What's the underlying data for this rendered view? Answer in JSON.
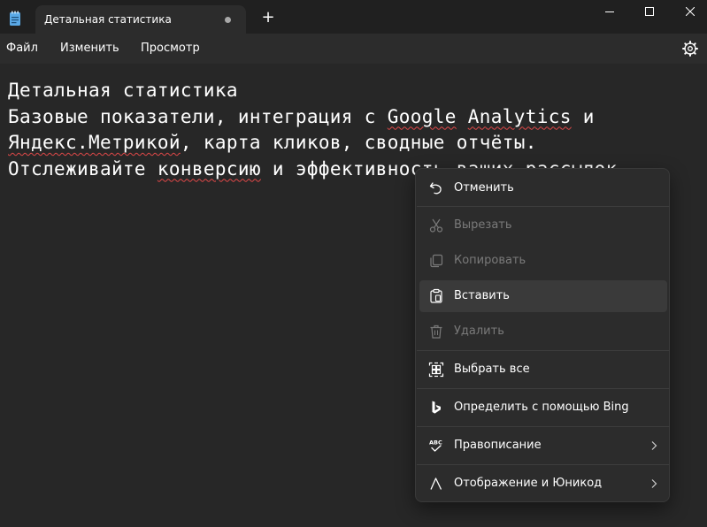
{
  "window": {
    "tab_title": "Детальная статистика",
    "new_tab_glyph": "+",
    "icons": [
      "notepad-app-icon",
      "unsaved-dot-icon",
      "minimize-icon",
      "maximize-icon",
      "close-icon"
    ]
  },
  "menubar": {
    "file": "Файл",
    "edit": "Изменить",
    "view": "Просмотр",
    "settings_icon": "gear-icon"
  },
  "editor": {
    "line1": "Детальная статистика",
    "line2_a": "Базовые показатели, интеграция с ",
    "line2_google": "Google",
    "line2_sp": " ",
    "line2_analytics": "Analytics",
    "line2_b": " и",
    "line3_yandex": "Яндекс.Метрикой",
    "line3_b": ", карта кликов, сводные отчёты.",
    "line4_a": "Отслеживайте ",
    "line4_conv": "конверсию",
    "line4_b": " и эффективность ваших рассылок.",
    "spellcheck_color": "#e04848"
  },
  "context_menu": {
    "items": [
      {
        "label": "Отменить",
        "icon": "undo-icon",
        "enabled": true
      },
      {
        "label": "Вырезать",
        "icon": "scissors-icon",
        "enabled": false
      },
      {
        "label": "Копировать",
        "icon": "copy-icon",
        "enabled": false
      },
      {
        "label": "Вставить",
        "icon": "clipboard-paste-icon",
        "enabled": true,
        "hovered": true
      },
      {
        "label": "Удалить",
        "icon": "trash-icon",
        "enabled": false
      },
      {
        "label": "Выбрать все",
        "icon": "select-all-icon",
        "enabled": true
      },
      {
        "label": "Определить с помощью Bing",
        "icon": "bing-icon",
        "enabled": true
      },
      {
        "label": "Правописание",
        "icon": "spellcheck-icon",
        "enabled": true,
        "submenu": true
      },
      {
        "label": "Отображение и Юникод",
        "icon": "unicode-icon",
        "enabled": true,
        "submenu": true
      }
    ]
  },
  "colors": {
    "background": "#272727",
    "titlebar": "#202020",
    "menu_surface": "#2c2c2c",
    "hover": "#3a3a3a",
    "text": "#ffffff",
    "disabled_text": "#7a7a7a",
    "accent_app_icon": "#5aa9e6"
  }
}
